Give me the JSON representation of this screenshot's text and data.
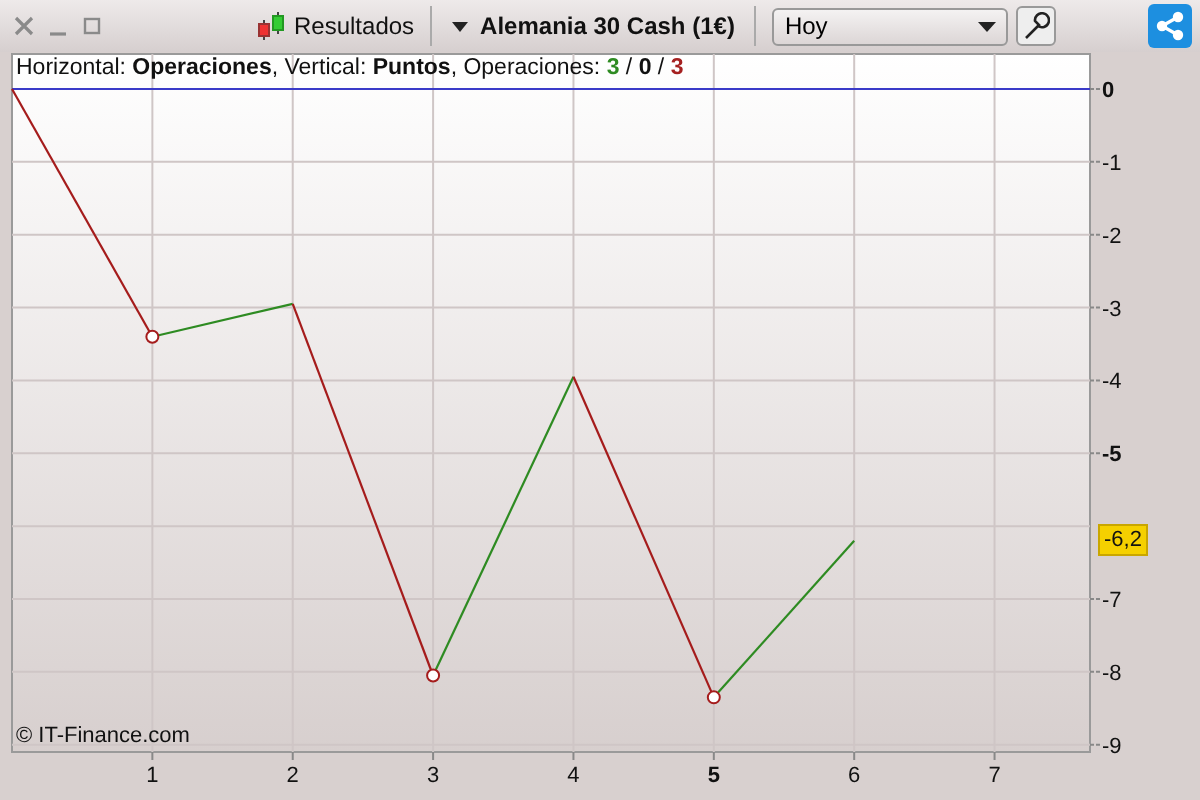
{
  "window": {
    "controls": [
      {
        "kind": "close"
      },
      {
        "kind": "minimize"
      },
      {
        "kind": "maximize"
      }
    ]
  },
  "toolbar": {
    "results_button": "Resultados",
    "instrument": "Alemania 30 Cash (1€)",
    "period": {
      "value": "Hoy"
    }
  },
  "chart": {
    "caption": "Horizontal: **Operaciones**, Vertical: **Puntos**, Operaciones: ",
    "counts": [
      {
        "text": "3",
        "color": "#2e8b22"
      },
      {
        "text": "0",
        "color": "#111111"
      },
      {
        "text": "3",
        "color": "#a52020"
      }
    ],
    "count_separator": "/",
    "copyright": "© IT-Finance.com",
    "current_value": "-6,2",
    "chart_data": {
      "type": "line",
      "x": [
        0,
        1,
        2,
        3,
        4,
        5,
        6
      ],
      "series": [
        {
          "color": "#a51c1c",
          "values": [
            0,
            -3.4,
            null,
            null,
            null,
            null,
            null
          ]
        },
        {
          "color": "#2e8b22",
          "values": [
            null,
            -3.4,
            -2.95,
            null,
            null,
            null,
            null
          ]
        },
        {
          "color": "#a51c1c",
          "values": [
            null,
            null,
            -2.95,
            -8.05,
            null,
            null,
            null
          ]
        },
        {
          "color": "#2e8b22",
          "values": [
            null,
            null,
            null,
            -8.05,
            -3.95,
            null,
            null
          ]
        },
        {
          "color": "#a51c1c",
          "values": [
            null,
            null,
            null,
            null,
            -3.95,
            -8.35,
            null
          ]
        },
        {
          "color": "#2e8b22",
          "values": [
            null,
            null,
            null,
            null,
            null,
            -8.35,
            -6.2
          ]
        }
      ],
      "grid": true,
      "xlim": [
        0,
        7.68
      ],
      "ylim": [
        -9.1,
        0.48
      ],
      "xticks": [
        1,
        2,
        3,
        4,
        5,
        6,
        7
      ],
      "yticks": [
        0,
        -1,
        -2,
        -3,
        -4,
        -5,
        -7,
        -8,
        -9
      ],
      "ref_lines": [
        {
          "axis": "y",
          "value": 0,
          "color": "#3a3ac8"
        }
      ]
    }
  }
}
